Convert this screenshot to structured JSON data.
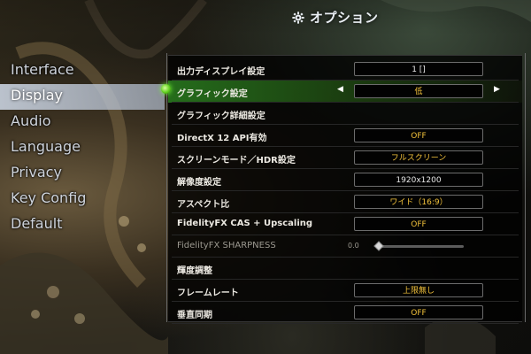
{
  "header": {
    "title": "オプション",
    "icon": "gear-icon"
  },
  "nav": {
    "active_index": 1,
    "items": [
      {
        "label": "Interface"
      },
      {
        "label": "Display"
      },
      {
        "label": "Audio"
      },
      {
        "label": "Language"
      },
      {
        "label": "Privacy"
      },
      {
        "label": "Key Config"
      },
      {
        "label": "Default"
      }
    ]
  },
  "settings": [
    {
      "label": "出力ディスプレイ設定",
      "value": "1 []",
      "value_color": "white"
    },
    {
      "label": "グラフィック設定",
      "value": "低",
      "left_arrow": "◀",
      "right_arrow": "▶",
      "active": true
    },
    {
      "label": "グラフィック詳細設定"
    },
    {
      "label": "DirectX 12 API有効",
      "value": "OFF"
    },
    {
      "label": "スクリーンモード／HDR設定",
      "value": "フルスクリーン"
    },
    {
      "label": "解像度設定",
      "value": "1920x1200",
      "value_color": "white"
    },
    {
      "label": "アスペクト比",
      "value": "ワイド（16:9）"
    },
    {
      "label": "FidelityFX CAS + Upscaling",
      "value": "OFF"
    },
    {
      "label": "FidelityFX SHARPNESS",
      "slider_value": "0.0",
      "slider_fraction": 0.0,
      "disabled": true
    },
    {
      "label": "輝度調整"
    },
    {
      "label": "フレームレート",
      "value": "上限無し"
    },
    {
      "label": "垂直同期",
      "value": "OFF"
    }
  ],
  "colors": {
    "accent_green": "#3c9a1f",
    "value_gold": "#f3c23b",
    "nav_highlight": "#c8d0dc"
  }
}
